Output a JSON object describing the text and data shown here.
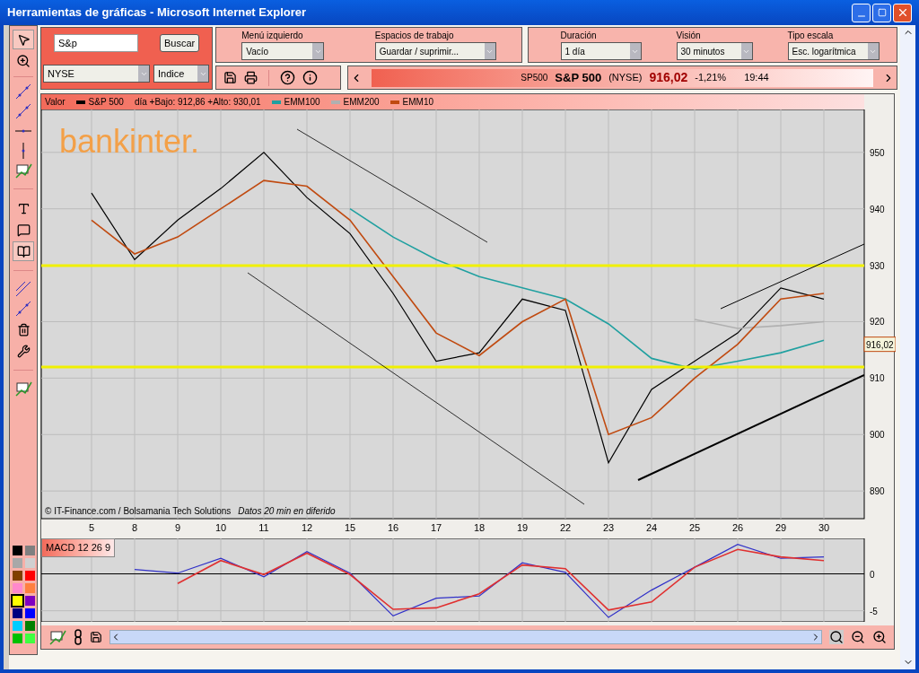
{
  "window": {
    "title": "Herramientas de gráficas - Microsoft Internet Explorer"
  },
  "search": {
    "value": "S&p",
    "button": "Buscar",
    "market": "NYSE",
    "type": "Indice"
  },
  "selectors": [
    {
      "label": "Menú izquierdo",
      "value": "Vacío"
    },
    {
      "label": "Espacios de trabajo",
      "value": "Guardar / suprimir..."
    },
    {
      "label": "Duración",
      "value": "1 día"
    },
    {
      "label": "Visión",
      "value": "30 minutos"
    },
    {
      "label": "Tipo escala",
      "value": "Esc. logarítmica"
    }
  ],
  "ticker": {
    "code": "SP500",
    "name": "S&P 500",
    "market": "(NYSE)",
    "price": "916,02",
    "change": "-1,21%",
    "time": "19:44"
  },
  "legend": {
    "label": "Valor",
    "range": "día +Bajo: 912,86 +Alto: 930,01"
  },
  "main_chart": {
    "logo_text": "bankinter.",
    "credit": "© IT-Finance.com / Bolsamania Tech Solutions",
    "credit_note": "Datos 20 min en diferido",
    "price_marker": "916,02",
    "chart_data": {
      "type": "line",
      "grid": true,
      "categories": [
        "5",
        "8",
        "9",
        "10",
        "11",
        "12",
        "15",
        "16",
        "17",
        "18",
        "19",
        "22",
        "23",
        "24",
        "25",
        "26",
        "29",
        "30"
      ],
      "series": [
        {
          "name": "S&P 500",
          "color": "#000000",
          "values": [
            942.8,
            931,
            938,
            943.6,
            950,
            942,
            935.6,
            925,
            913,
            914.5,
            924,
            922,
            895,
            908,
            913,
            918,
            926,
            924
          ]
        },
        {
          "name": "EMM100",
          "color": "#20a0a0",
          "values": [
            null,
            null,
            null,
            null,
            null,
            null,
            940,
            935,
            931,
            928,
            926,
            924,
            919.6,
            913.5,
            911.6,
            913,
            914.5,
            916.7
          ]
        },
        {
          "name": "EMM200",
          "color": "#b0b0b0",
          "values": [
            null,
            null,
            null,
            null,
            null,
            null,
            null,
            null,
            null,
            null,
            null,
            null,
            null,
            null,
            920.4,
            918.8,
            919.3,
            920
          ]
        },
        {
          "name": "EMM10",
          "color": "#c04a10",
          "values": [
            938,
            932,
            935,
            940,
            945,
            944,
            938,
            928,
            918,
            914,
            920,
            924,
            900,
            903,
            910,
            916,
            924,
            925
          ]
        }
      ],
      "ylim": [
        885.1,
        957.6
      ],
      "yticks": [
        890,
        900,
        910,
        920,
        930,
        940,
        950
      ]
    }
  },
  "macd": {
    "title": "MACD 12 26 9",
    "chart_data": {
      "type": "line",
      "grid": true,
      "series": [
        {
          "color": "#3030c8",
          "values": [
            null,
            0.6,
            0.1,
            2.1,
            -0.4,
            3,
            0.1,
            -5.7,
            -3.3,
            -3,
            1.5,
            0.2,
            -5.9,
            -2.2,
            0.9,
            4,
            2.1,
            2.3
          ]
        },
        {
          "color": "#e03030",
          "values": [
            null,
            null,
            -1.3,
            1.8,
            -0.1,
            2.8,
            -0.1,
            -4.8,
            -4.6,
            -2.7,
            1.2,
            0.7,
            -4.9,
            -3.8,
            0.9,
            3.3,
            2.3,
            1.8
          ]
        }
      ],
      "ylim": [
        -6.5,
        4.8
      ],
      "yticks": [
        -5,
        0
      ]
    }
  },
  "palette": [
    {
      "color": "#000000",
      "selected": false
    },
    {
      "color": "#808080",
      "selected": false
    },
    {
      "color": "#a8a8a8",
      "selected": false
    },
    {
      "color": "#d0d0d0",
      "selected": false
    },
    {
      "color": "#804000",
      "selected": false
    },
    {
      "color": "#ff0000",
      "selected": false
    },
    {
      "color": "#ff88cc",
      "selected": false
    },
    {
      "color": "#ff8040",
      "selected": false
    },
    {
      "color": "#ffff00",
      "selected": true
    },
    {
      "color": "#8000c0",
      "selected": false
    },
    {
      "color": "#000080",
      "selected": false
    },
    {
      "color": "#0000ff",
      "selected": false
    },
    {
      "color": "#00ccff",
      "selected": false
    },
    {
      "color": "#008000",
      "selected": false
    },
    {
      "color": "#00c000",
      "selected": false
    },
    {
      "color": "#40ff40",
      "selected": false
    }
  ]
}
